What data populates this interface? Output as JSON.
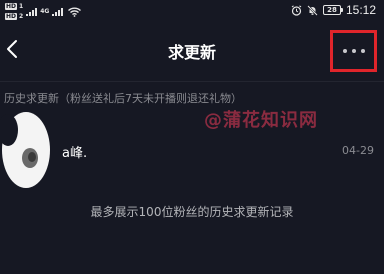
{
  "status_bar": {
    "hd1": "HD",
    "hd1_num": "1",
    "hd2": "HD",
    "hd2_num": "2",
    "net": "4G",
    "battery": "28",
    "time": "15:12"
  },
  "nav": {
    "title": "求更新"
  },
  "section": {
    "header": "历史求更新（粉丝送礼后7天未开播则退还礼物）"
  },
  "watermark": "@蒲花知识网",
  "list": [
    {
      "name": "a峰.",
      "date": "04-29"
    }
  ],
  "footer": {
    "note": "最多展示100位粉丝的历史求更新记录"
  },
  "colors": {
    "background": "#161823",
    "highlight_box": "#e0252b",
    "muted_text": "#8a8b91"
  }
}
